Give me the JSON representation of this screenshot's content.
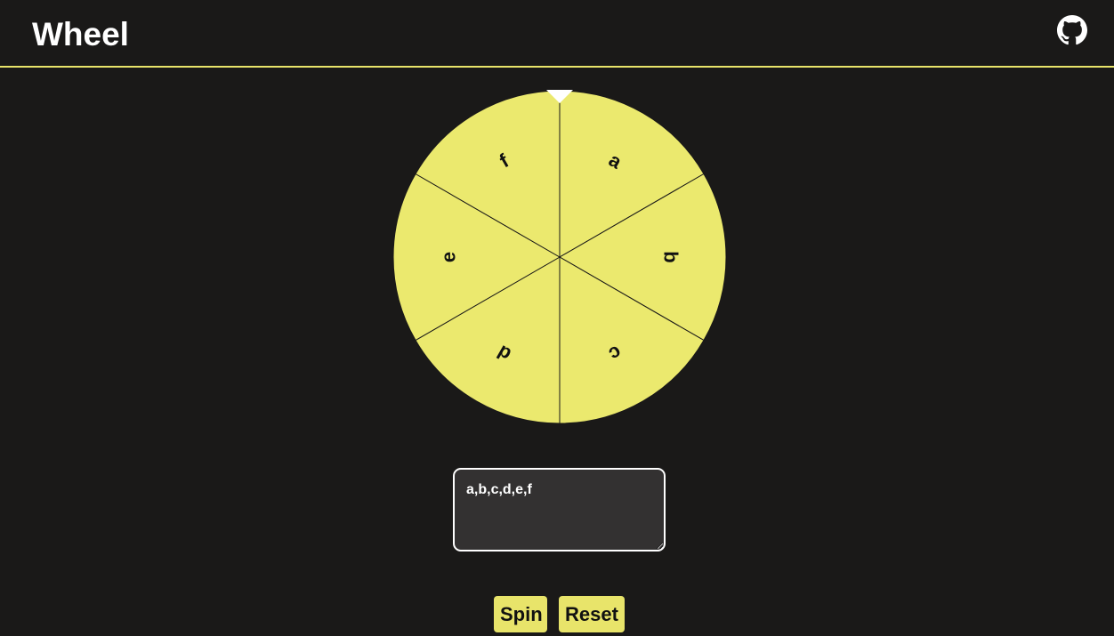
{
  "header": {
    "title": "Wheel",
    "github_icon": "github-icon"
  },
  "wheel": {
    "segment_color": "#ebe96e",
    "divider_color": "#1a1918",
    "pointer_color": "#ffffff",
    "segments": [
      "a",
      "b",
      "c",
      "d",
      "e",
      "f"
    ]
  },
  "entries": {
    "value": "a,b,c,d,e,f"
  },
  "buttons": {
    "spin_label": "Spin",
    "reset_label": "Reset"
  },
  "colors": {
    "background": "#1a1918",
    "accent": "#e8e46a",
    "textarea_bg": "#333131"
  }
}
